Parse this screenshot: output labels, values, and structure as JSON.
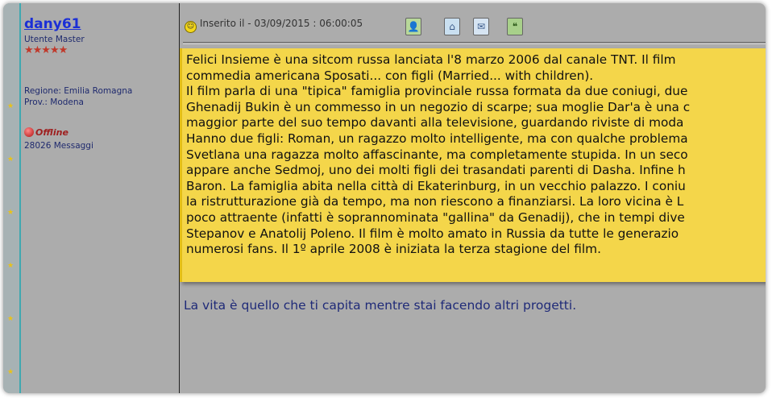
{
  "author": {
    "username": "dany61",
    "rank": "Utente Master",
    "rank_stars": "★★★★★",
    "region": "Regione: Emilia Romagna",
    "province": "Prov.: Modena",
    "status": "Offline",
    "messages": "28026 Messaggi"
  },
  "post": {
    "posted_label": "Inserito il - 03/09/2015 : 06:00:05",
    "toolbar_icons": [
      "profile-icon",
      "home-icon",
      "email-icon",
      "quote-icon"
    ],
    "body_lines": [
      "Felici Insieme è una sitcom russa lanciata l'8 marzo 2006 dal canale TNT. Il film",
      "commedia americana Sposati... con figli (Married... with children).",
      "Il film parla di una \"tipica\" famiglia provinciale russa formata da due coniugi, due",
      "Ghenadij Bukin è un commesso in un negozio di scarpe; sua moglie Dar'a è una c",
      "maggior parte del suo tempo davanti alla televisione, guardando riviste di moda",
      "Hanno due figli: Roman, un ragazzo molto intelligente, ma con qualche problema",
      "Svetlana una ragazza molto affascinante, ma completamente stupida. In un seco",
      "appare anche Sedmoj, uno dei molti figli dei trasandati parenti di Dasha. Infine h",
      "Baron. La famiglia abita nella città di Ekaterinburg, in un vecchio palazzo. I coniu",
      "la ristrutturazione già da tempo, ma non riescono a finanziarsi. La loro vicina è L",
      "poco attraente (infatti è soprannominata \"gallina\" da Genadij), che in tempi dive",
      "Stepanov e Anatolij Poleno. Il film è molto amato in Russia da tutte le generazio",
      "numerosi fans. Il 1º aprile 2008 è iniziata la terza stagione del film."
    ],
    "signature": "La vita è quello che ti capita mentre stai facendo altri progetti."
  },
  "colors": {
    "quote_background": "#f4d64a",
    "username": "#1b2fd6",
    "panel": "#acacac"
  }
}
